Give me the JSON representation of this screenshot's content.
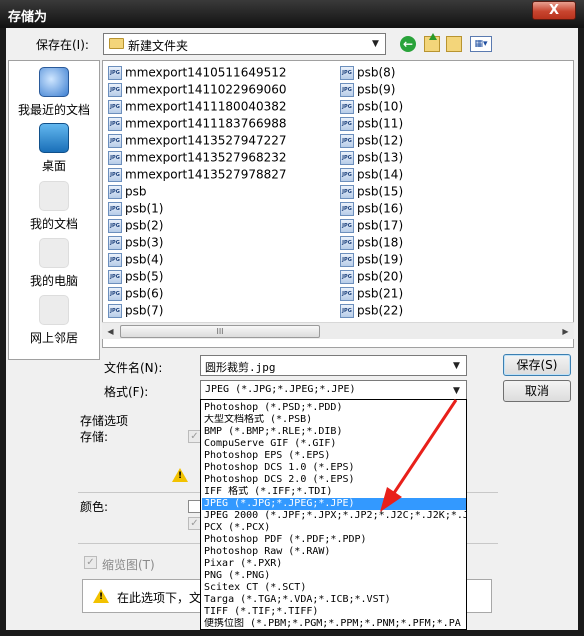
{
  "window": {
    "title": "存储为",
    "close_label": "X"
  },
  "lookin": {
    "label": "保存在(I):",
    "value": "新建文件夹"
  },
  "places": [
    {
      "label": "我最近的文档",
      "icon": "recent-documents-icon"
    },
    {
      "label": "桌面",
      "icon": "desktop-icon"
    },
    {
      "label": "我的文档",
      "icon": "my-documents-icon"
    },
    {
      "label": "我的电脑",
      "icon": "my-computer-icon"
    },
    {
      "label": "网上邻居",
      "icon": "network-places-icon"
    }
  ],
  "files_left": [
    "mmexport1410511649512",
    "mmexport1411022969060",
    "mmexport1411180040382",
    "mmexport1411183766988",
    "mmexport1413527947227",
    "mmexport1413527968232",
    "mmexport1413527978827",
    "psb",
    "psb(1)",
    "psb(2)",
    "psb(3)",
    "psb(4)",
    "psb(5)",
    "psb(6)",
    "psb(7)"
  ],
  "files_right": [
    "psb(8)",
    "psb(9)",
    "psb(10)",
    "psb(11)",
    "psb(12)",
    "psb(13)",
    "psb(14)",
    "psb(15)",
    "psb(16)",
    "psb(17)",
    "psb(18)",
    "psb(19)",
    "psb(20)",
    "psb(21)",
    "psb(22)"
  ],
  "file_icon_text": "JPG",
  "scroll_thumb_text": "III",
  "filename": {
    "label": "文件名(N):",
    "value": "圆形裁剪.jpg"
  },
  "format": {
    "label": "格式(F):",
    "value": "JPEG (*.JPG;*.JPEG;*.JPE)"
  },
  "buttons": {
    "save": "保存(S)",
    "cancel": "取消"
  },
  "options": {
    "title": "存储选项",
    "save_label": "存储:",
    "color_label": "颜色:",
    "thumbnail_label": "缩览图(T)",
    "info_text": "在此选项下，文"
  },
  "dropdown_options": [
    "Photoshop (*.PSD;*.PDD)",
    "大型文档格式 (*.PSB)",
    "BMP (*.BMP;*.RLE;*.DIB)",
    "CompuServe GIF (*.GIF)",
    "Photoshop EPS (*.EPS)",
    "Photoshop DCS 1.0 (*.EPS)",
    "Photoshop DCS 2.0 (*.EPS)",
    "IFF 格式 (*.IFF;*.TDI)",
    "JPEG (*.JPG;*.JPEG;*.JPE)",
    "JPEG 2000 (*.JPF;*.JPX;*.JP2;*.J2C;*.J2K;*.J",
    "PCX (*.PCX)",
    "Photoshop PDF (*.PDF;*.PDP)",
    "Photoshop Raw (*.RAW)",
    "Pixar (*.PXR)",
    "PNG (*.PNG)",
    "Scitex CT (*.SCT)",
    "Targa (*.TGA;*.VDA;*.ICB;*.VST)",
    "TIFF (*.TIF;*.TIFF)",
    "便携位图 (*.PBM;*.PGM;*.PPM;*.PNM;*.PFM;*.PA"
  ],
  "selected_option_index": 8,
  "colors": {
    "selection": "#3399ff",
    "annotation_arrow": "#e8201a"
  }
}
